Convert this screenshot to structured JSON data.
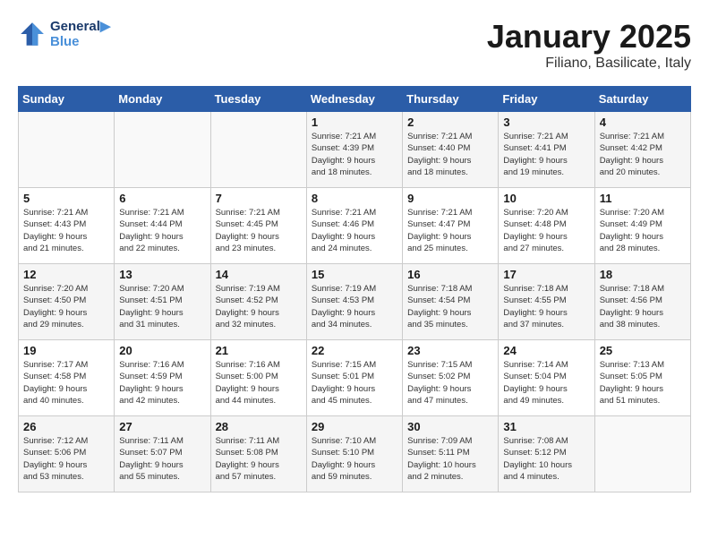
{
  "header": {
    "logo_line1": "General",
    "logo_line2": "Blue",
    "title": "January 2025",
    "subtitle": "Filiano, Basilicate, Italy"
  },
  "weekdays": [
    "Sunday",
    "Monday",
    "Tuesday",
    "Wednesday",
    "Thursday",
    "Friday",
    "Saturday"
  ],
  "weeks": [
    [
      {
        "day": "",
        "info": ""
      },
      {
        "day": "",
        "info": ""
      },
      {
        "day": "",
        "info": ""
      },
      {
        "day": "1",
        "info": "Sunrise: 7:21 AM\nSunset: 4:39 PM\nDaylight: 9 hours\nand 18 minutes."
      },
      {
        "day": "2",
        "info": "Sunrise: 7:21 AM\nSunset: 4:40 PM\nDaylight: 9 hours\nand 18 minutes."
      },
      {
        "day": "3",
        "info": "Sunrise: 7:21 AM\nSunset: 4:41 PM\nDaylight: 9 hours\nand 19 minutes."
      },
      {
        "day": "4",
        "info": "Sunrise: 7:21 AM\nSunset: 4:42 PM\nDaylight: 9 hours\nand 20 minutes."
      }
    ],
    [
      {
        "day": "5",
        "info": "Sunrise: 7:21 AM\nSunset: 4:43 PM\nDaylight: 9 hours\nand 21 minutes."
      },
      {
        "day": "6",
        "info": "Sunrise: 7:21 AM\nSunset: 4:44 PM\nDaylight: 9 hours\nand 22 minutes."
      },
      {
        "day": "7",
        "info": "Sunrise: 7:21 AM\nSunset: 4:45 PM\nDaylight: 9 hours\nand 23 minutes."
      },
      {
        "day": "8",
        "info": "Sunrise: 7:21 AM\nSunset: 4:46 PM\nDaylight: 9 hours\nand 24 minutes."
      },
      {
        "day": "9",
        "info": "Sunrise: 7:21 AM\nSunset: 4:47 PM\nDaylight: 9 hours\nand 25 minutes."
      },
      {
        "day": "10",
        "info": "Sunrise: 7:20 AM\nSunset: 4:48 PM\nDaylight: 9 hours\nand 27 minutes."
      },
      {
        "day": "11",
        "info": "Sunrise: 7:20 AM\nSunset: 4:49 PM\nDaylight: 9 hours\nand 28 minutes."
      }
    ],
    [
      {
        "day": "12",
        "info": "Sunrise: 7:20 AM\nSunset: 4:50 PM\nDaylight: 9 hours\nand 29 minutes."
      },
      {
        "day": "13",
        "info": "Sunrise: 7:20 AM\nSunset: 4:51 PM\nDaylight: 9 hours\nand 31 minutes."
      },
      {
        "day": "14",
        "info": "Sunrise: 7:19 AM\nSunset: 4:52 PM\nDaylight: 9 hours\nand 32 minutes."
      },
      {
        "day": "15",
        "info": "Sunrise: 7:19 AM\nSunset: 4:53 PM\nDaylight: 9 hours\nand 34 minutes."
      },
      {
        "day": "16",
        "info": "Sunrise: 7:18 AM\nSunset: 4:54 PM\nDaylight: 9 hours\nand 35 minutes."
      },
      {
        "day": "17",
        "info": "Sunrise: 7:18 AM\nSunset: 4:55 PM\nDaylight: 9 hours\nand 37 minutes."
      },
      {
        "day": "18",
        "info": "Sunrise: 7:18 AM\nSunset: 4:56 PM\nDaylight: 9 hours\nand 38 minutes."
      }
    ],
    [
      {
        "day": "19",
        "info": "Sunrise: 7:17 AM\nSunset: 4:58 PM\nDaylight: 9 hours\nand 40 minutes."
      },
      {
        "day": "20",
        "info": "Sunrise: 7:16 AM\nSunset: 4:59 PM\nDaylight: 9 hours\nand 42 minutes."
      },
      {
        "day": "21",
        "info": "Sunrise: 7:16 AM\nSunset: 5:00 PM\nDaylight: 9 hours\nand 44 minutes."
      },
      {
        "day": "22",
        "info": "Sunrise: 7:15 AM\nSunset: 5:01 PM\nDaylight: 9 hours\nand 45 minutes."
      },
      {
        "day": "23",
        "info": "Sunrise: 7:15 AM\nSunset: 5:02 PM\nDaylight: 9 hours\nand 47 minutes."
      },
      {
        "day": "24",
        "info": "Sunrise: 7:14 AM\nSunset: 5:04 PM\nDaylight: 9 hours\nand 49 minutes."
      },
      {
        "day": "25",
        "info": "Sunrise: 7:13 AM\nSunset: 5:05 PM\nDaylight: 9 hours\nand 51 minutes."
      }
    ],
    [
      {
        "day": "26",
        "info": "Sunrise: 7:12 AM\nSunset: 5:06 PM\nDaylight: 9 hours\nand 53 minutes."
      },
      {
        "day": "27",
        "info": "Sunrise: 7:11 AM\nSunset: 5:07 PM\nDaylight: 9 hours\nand 55 minutes."
      },
      {
        "day": "28",
        "info": "Sunrise: 7:11 AM\nSunset: 5:08 PM\nDaylight: 9 hours\nand 57 minutes."
      },
      {
        "day": "29",
        "info": "Sunrise: 7:10 AM\nSunset: 5:10 PM\nDaylight: 9 hours\nand 59 minutes."
      },
      {
        "day": "30",
        "info": "Sunrise: 7:09 AM\nSunset: 5:11 PM\nDaylight: 10 hours\nand 2 minutes."
      },
      {
        "day": "31",
        "info": "Sunrise: 7:08 AM\nSunset: 5:12 PM\nDaylight: 10 hours\nand 4 minutes."
      },
      {
        "day": "",
        "info": ""
      }
    ]
  ]
}
